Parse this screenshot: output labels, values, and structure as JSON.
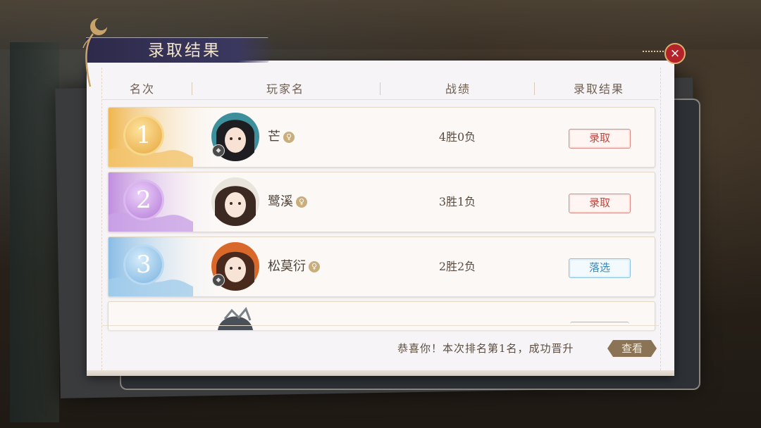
{
  "dialog": {
    "title": "录取结果",
    "close_label": "×"
  },
  "table": {
    "headers": [
      "名次",
      "玩家名",
      "战绩",
      "录取结果"
    ],
    "rows": [
      {
        "rank": "1",
        "name": "芒",
        "record": "4胜0负",
        "result": "录取",
        "result_type": "accepted",
        "rank_color": "#f0c060"
      },
      {
        "rank": "2",
        "name": "鹭溪",
        "record": "3胜1负",
        "result": "录取",
        "result_type": "accepted",
        "rank_color": "#c79be0"
      },
      {
        "rank": "3",
        "name": "松莫衍",
        "record": "2胜2负",
        "result": "落选",
        "result_type": "rejected",
        "rank_color": "#8cc0e4"
      }
    ]
  },
  "footer": {
    "message": "恭喜你！本次排名第1名，成功晋升",
    "view_label": "查看"
  },
  "colors": {
    "accepted": "#c4453d",
    "rejected": "#3a86b8",
    "title_bar": "#2d2a4a",
    "close_button": "#b5232a"
  }
}
